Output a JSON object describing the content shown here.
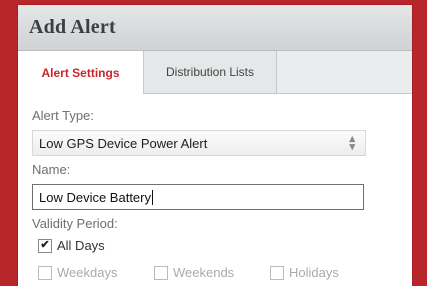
{
  "dialog": {
    "title": "Add Alert"
  },
  "tabs": [
    {
      "label": "Alert Settings",
      "active": true
    },
    {
      "label": "Distribution Lists",
      "active": false
    }
  ],
  "form": {
    "alert_type_label": "Alert Type:",
    "alert_type_value": "Low GPS Device Power Alert",
    "name_label": "Name:",
    "name_value": "Low Device Battery",
    "validity_label": "Validity Period:",
    "all_days_label": "All Days",
    "all_days_checked": true,
    "days": [
      {
        "label": "Weekdays",
        "checked": false
      },
      {
        "label": "Weekends",
        "checked": false
      },
      {
        "label": "Holidays",
        "checked": false
      }
    ]
  },
  "colors": {
    "brand": "#b8262c",
    "active_tab": "#c8262d"
  }
}
